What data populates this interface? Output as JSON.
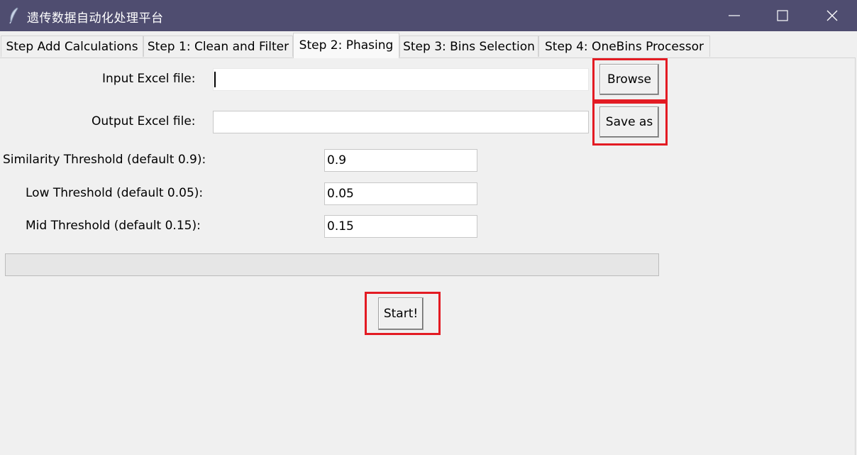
{
  "window": {
    "title": "遗传数据自动化处理平台",
    "icon": "feather-icon",
    "controls": [
      "minimize-icon",
      "maximize-icon",
      "close-icon"
    ]
  },
  "tabs": [
    {
      "label": "Step Add Calculations",
      "active": false
    },
    {
      "label": "Step 1: Clean and Filter",
      "active": false
    },
    {
      "label": "Step 2: Phasing",
      "active": true
    },
    {
      "label": "Step 3: Bins Selection",
      "active": false
    },
    {
      "label": "Step 4: OneBins Processor",
      "active": false
    }
  ],
  "form": {
    "input_file": {
      "label": "Input Excel file:",
      "value": "",
      "button": "Browse"
    },
    "output_file": {
      "label": "Output Excel file:",
      "value": "",
      "button": "Save as"
    },
    "similarity": {
      "label": "Similarity Threshold (default 0.9):",
      "value": "0.9"
    },
    "low": {
      "label": "Low Threshold (default 0.05):",
      "value": "0.05"
    },
    "mid": {
      "label": "Mid Threshold (default 0.15):",
      "value": "0.15"
    }
  },
  "progress": {
    "value": 0
  },
  "start_button": "Start!",
  "colors": {
    "titlebar": "#4f4d70",
    "highlight": "#e31b23",
    "background": "#f0f0f0"
  }
}
